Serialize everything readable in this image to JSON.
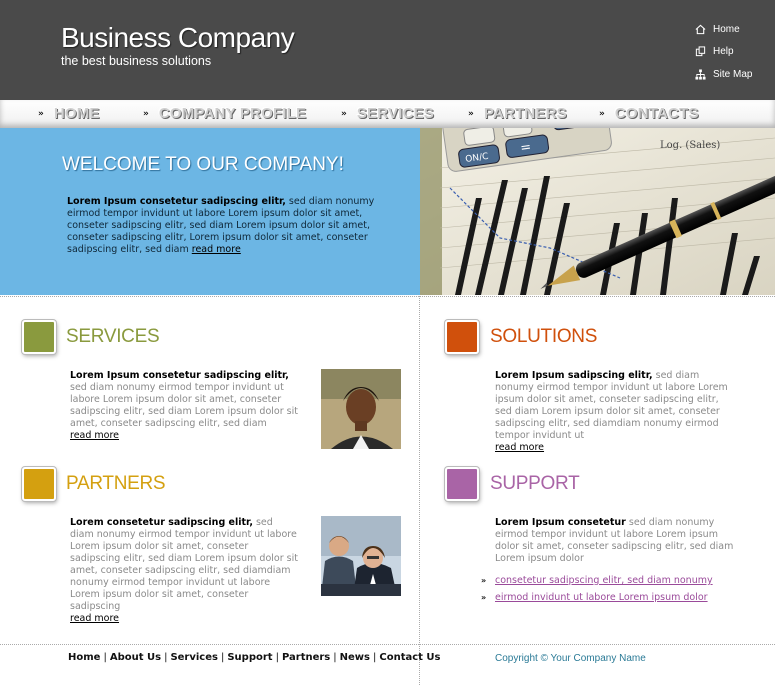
{
  "header": {
    "brand_title": "Business Company",
    "brand_tagline": "the best business solutions",
    "util_links": [
      {
        "label": "Home",
        "icon": "home-icon"
      },
      {
        "label": "Help",
        "icon": "help-icon"
      },
      {
        "label": "Site Map",
        "icon": "sitemap-icon"
      }
    ]
  },
  "nav": {
    "items": [
      "HOME",
      "COMPANY PROFILE",
      "SERVICES",
      "PARTNERS",
      "CONTACTS"
    ]
  },
  "welcome": {
    "title": "WELCOME TO OUR COMPANY!",
    "bold": "Lorem Ipsum consetetur sadipscing elitr,",
    "text": " sed diam nonumy eirmod tempor invidunt ut labore Lorem ipsum dolor sit amet, conseter sadipscing elitr, sed diam Lorem ipsum dolor sit amet, conseter sadipscing elitr,  Lorem ipsum dolor sit amet, conseter sadipscing elitr, sed diam ",
    "more": "read more"
  },
  "sections": {
    "services": {
      "title": "SERVICES",
      "bold": "Lorem Ipsum consetetur sadipscing elitr,",
      "text": " sed diam nonumy eirmod tempor invidunt ut labore Lorem ipsum dolor sit amet, conseter sadipscing elitr, sed diam Lorem ipsum dolor sit amet, conseter sadipscing elitr, sed diam",
      "more": "read more"
    },
    "solutions": {
      "title": "SOLUTIONS",
      "bold": "Lorem Ipsum sadipscing elitr,",
      "text": " sed diam nonumy eirmod tempor invidunt ut labore Lorem ipsum dolor sit amet, conseter sadipscing elitr, sed diam Lorem ipsum dolor sit amet, conseter sadipscing elitr, sed diamdiam nonumy eirmod tempor invidunt ut",
      "more": "read more"
    },
    "partners": {
      "title": "PARTNERS",
      "bold": "Lorem consetetur sadipscing elitr,",
      "text": " sed diam nonumy eirmod tempor invidunt ut labore Lorem ipsum dolor sit amet, conseter sadipscing elitr, sed diam Lorem ipsum dolor sit amet, conseter sadipscing elitr, sed diamdiam nonumy eirmod tempor invidunt ut labore Lorem ipsum dolor sit amet, conseter sadipscing",
      "more": "read more"
    },
    "support": {
      "title": "SUPPORT",
      "bold": "Lorem Ipsum consetetur",
      "text": " sed diam nonumy eirmod tempor invidunt ut labore Lorem ipsum dolor sit amet, conseter sadipscing elitr, sed diam Lorem ipsum dolor",
      "links": [
        "consetetur sadipscing elitr, sed diam nonumy",
        "eirmod invidunt ut labore Lorem ipsum dolor"
      ]
    }
  },
  "colors": {
    "services": "#8a9a3e",
    "solutions": "#d0500c",
    "partners": "#d4a010",
    "support": "#a964a6",
    "welcome_bg": "#6cb6e4",
    "header_bg": "#4a4a4a"
  },
  "footer": {
    "links": [
      "Home",
      "About Us",
      "Services",
      "Support",
      "Partners",
      "News",
      "Contact Us"
    ],
    "copyright": "Copyright © Your Company Name"
  }
}
